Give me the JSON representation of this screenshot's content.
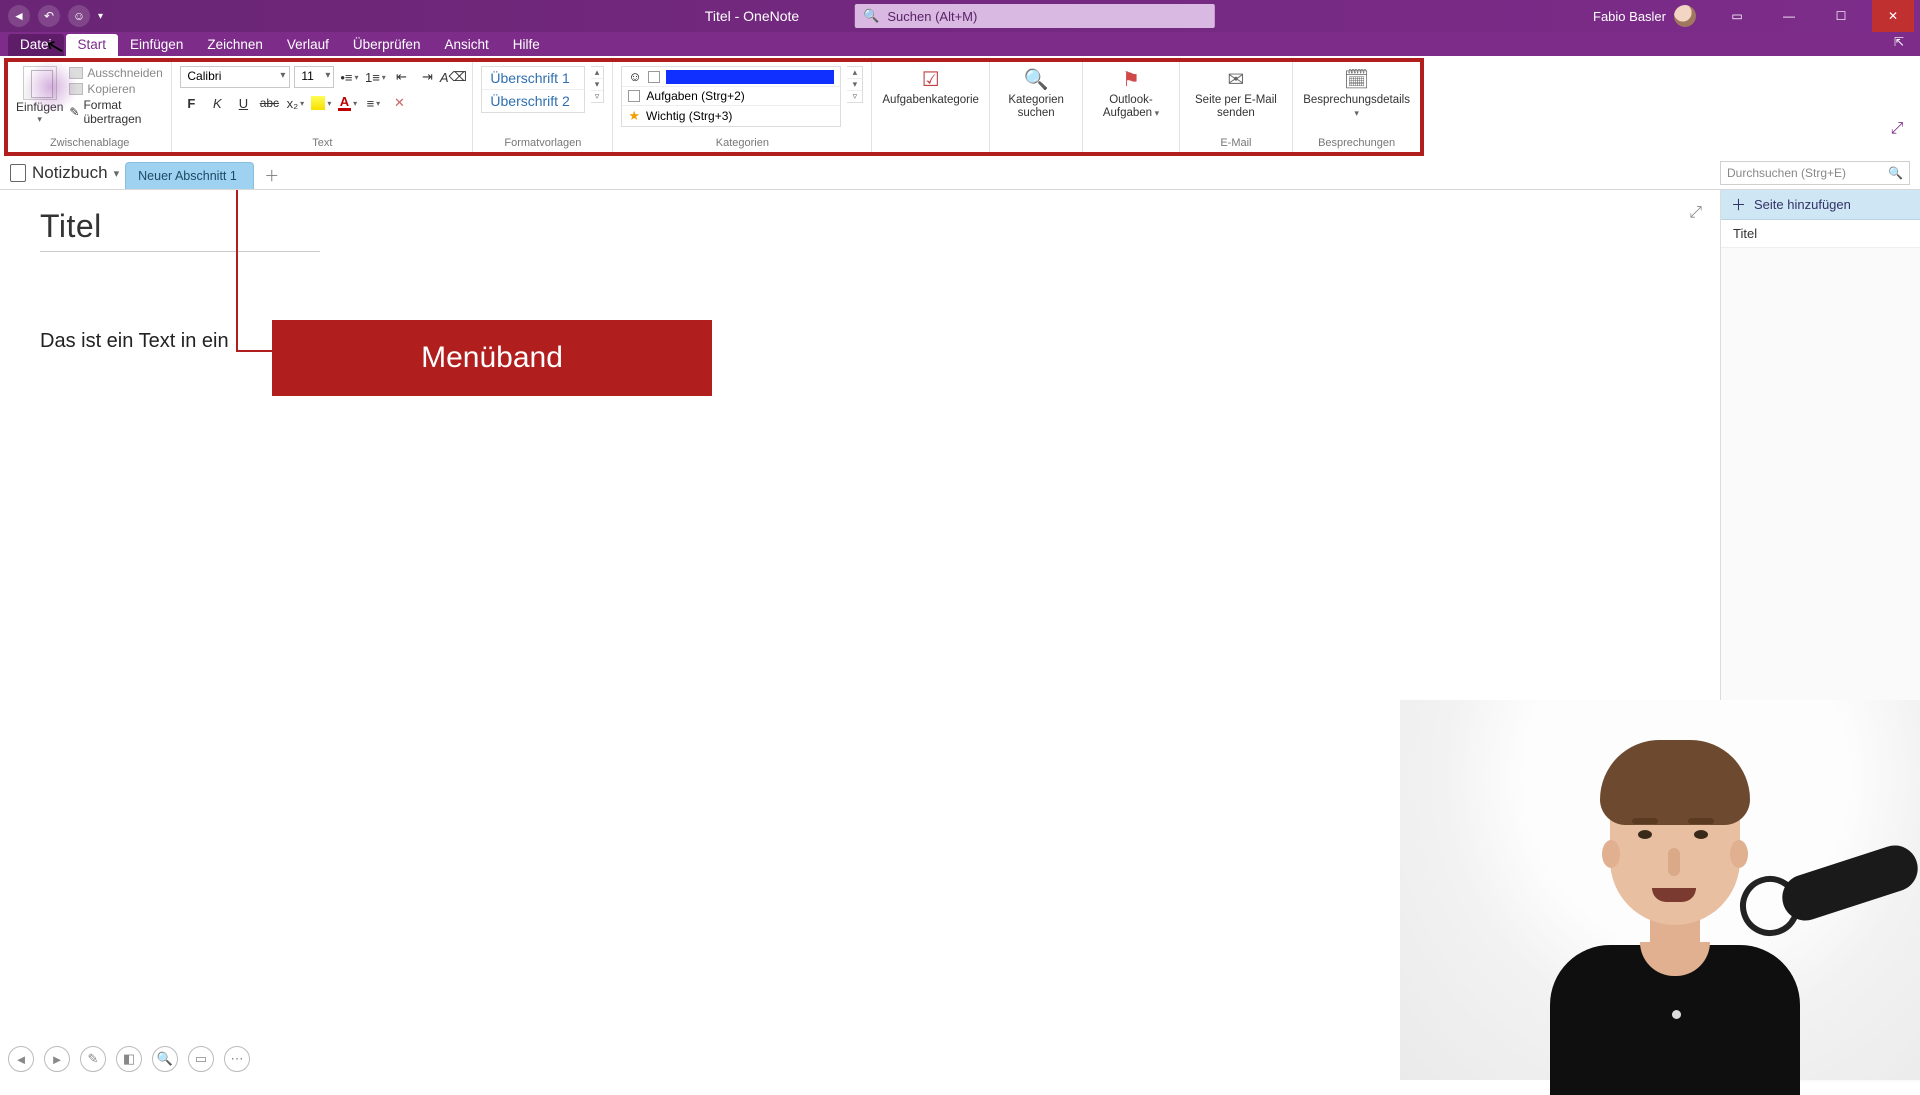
{
  "titlebar": {
    "doc_title": "Titel  -  OneNote",
    "search_placeholder": "Suchen (Alt+M)",
    "user_name": "Fabio Basler"
  },
  "tabs": {
    "file": "Datei",
    "items": [
      "Start",
      "Einfügen",
      "Zeichnen",
      "Verlauf",
      "Überprüfen",
      "Ansicht",
      "Hilfe"
    ],
    "active_index": 0
  },
  "ribbon": {
    "clipboard": {
      "paste": "Einfügen",
      "cut": "Ausschneiden",
      "copy": "Kopieren",
      "format_painter": "Format übertragen",
      "group_label": "Zwischenablage"
    },
    "text": {
      "font": "Calibri",
      "size": "11",
      "group_label": "Text"
    },
    "styles": {
      "items": [
        "Überschrift 1",
        "Überschrift 2"
      ],
      "group_label": "Formatvorlagen"
    },
    "tags": {
      "rows": [
        {
          "label": ""
        },
        {
          "label": "Aufgaben (Strg+2)"
        },
        {
          "label": "Wichtig (Strg+3)"
        }
      ],
      "task_category": "Aufgabenkategorie",
      "find_tags": "Kategorien suchen",
      "group_label": "Kategorien"
    },
    "outlook": {
      "label": "Outlook-Aufgaben"
    },
    "email": {
      "label": "Seite per E-Mail senden",
      "group_label": "E-Mail"
    },
    "meeting": {
      "label": "Besprechungsdetails",
      "group_label": "Besprechungen"
    }
  },
  "notebook": {
    "name": "Notizbuch",
    "section": "Neuer Abschnitt 1",
    "search_placeholder": "Durchsuchen (Strg+E)"
  },
  "page": {
    "title": "Titel",
    "body": "Das ist ein Text in ein",
    "callout": "Menüband"
  },
  "pagepanel": {
    "add_page": "Seite hinzufügen",
    "pages": [
      "Titel"
    ]
  }
}
